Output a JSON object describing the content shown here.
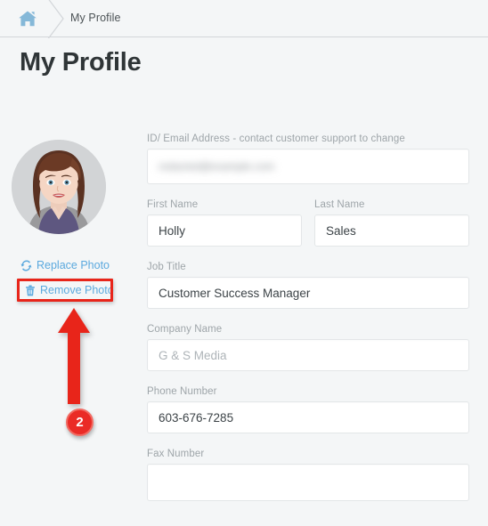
{
  "breadcrumb": {
    "home_icon": "home-icon",
    "separator_icon": "chevron-right-icon",
    "current": "My Profile"
  },
  "header": {
    "title": "My Profile"
  },
  "profile_photo": {
    "alt": "user avatar illustration",
    "replace_label": "Replace Photo",
    "replace_icon": "refresh-icon",
    "remove_label": "Remove Photo",
    "remove_icon": "trash-icon"
  },
  "annotation": {
    "step_number": "2",
    "arrow_icon": "up-arrow-icon",
    "highlight_color": "#e8251a",
    "badge_color": "#ea2b26"
  },
  "form": {
    "fields": [
      {
        "id": "field-email",
        "label": "ID/ Email Address - contact customer support to change",
        "value": "redacted@example.com",
        "redacted": true,
        "placeholder": ""
      },
      {
        "id": "field-first-name",
        "label": "First Name",
        "value": "Holly",
        "redacted": false,
        "placeholder": ""
      },
      {
        "id": "field-last-name",
        "label": "Last Name",
        "value": "Sales",
        "redacted": false,
        "placeholder": ""
      },
      {
        "id": "field-job-title",
        "label": "Job Title",
        "value": "Customer Success Manager",
        "redacted": false,
        "placeholder": ""
      },
      {
        "id": "field-company-name",
        "label": "Company Name",
        "value": "",
        "redacted": false,
        "placeholder": "G & S Media"
      },
      {
        "id": "field-phone-number",
        "label": "Phone Number",
        "value": "603-676-7285",
        "redacted": false,
        "placeholder": ""
      },
      {
        "id": "field-fax-number",
        "label": "Fax Number",
        "value": "",
        "redacted": false,
        "placeholder": ""
      }
    ]
  },
  "colors": {
    "page_bg": "#f4f6f7",
    "link_blue": "#5ba9de",
    "label_gray": "#9ea5a9",
    "title_dark": "#2f3537"
  }
}
